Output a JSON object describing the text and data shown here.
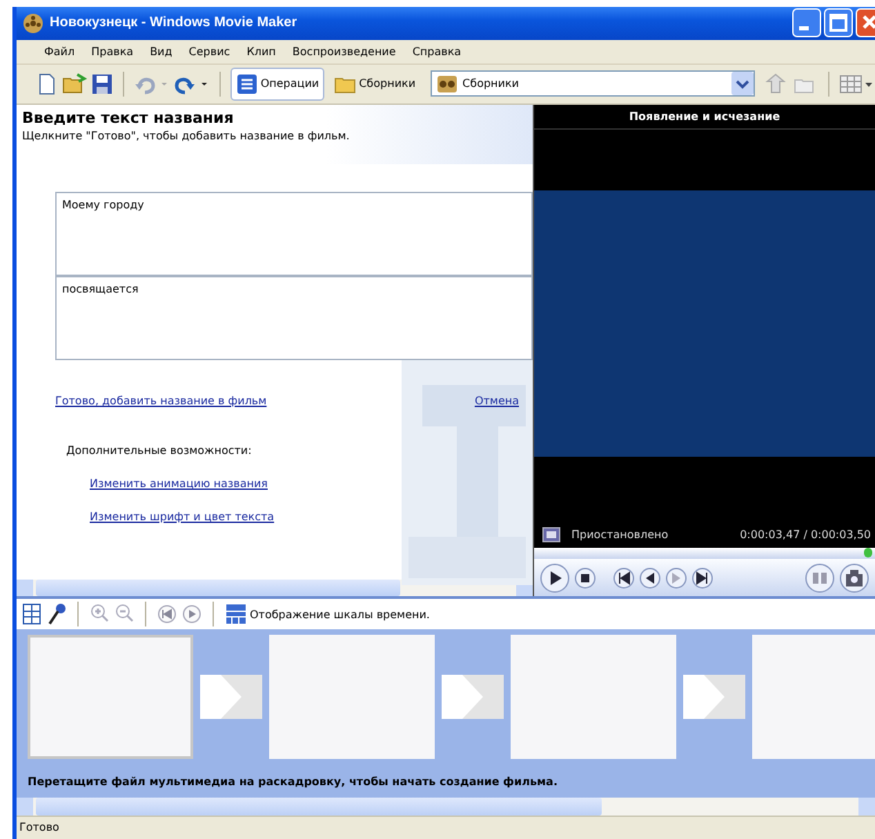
{
  "window": {
    "title": "Новокузнецк - Windows Movie Maker"
  },
  "menu": [
    "Файл",
    "Правка",
    "Вид",
    "Сервис",
    "Клип",
    "Воспроизведение",
    "Справка"
  ],
  "toolbar": {
    "panes": [
      {
        "label": "Операции",
        "selected": true
      },
      {
        "label": "Сборники",
        "selected": false
      }
    ],
    "collection": "Сборники"
  },
  "title_pane": {
    "heading": "Введите текст названия",
    "hint": "Щелкните \"Готово\", чтобы добавить название в фильм.",
    "fields": [
      {
        "value": "Моему городу"
      },
      {
        "value": "посвящается"
      }
    ],
    "done_link": "Готово, добавить название в фильм",
    "cancel_link": "Отмена",
    "more_label": "Дополнительные возможности:",
    "more_links": [
      "Изменить анимацию названия",
      "Изменить шрифт и цвет текста"
    ]
  },
  "preview": {
    "title": "Появление и исчезание",
    "status": "Приостановлено",
    "time": "0:00:03,47 / 0:00:03,50",
    "level": 0.99
  },
  "storyboard": {
    "toggle_label": "Отображение шкалы времени.",
    "frames": [
      {
        "selected": true
      },
      {
        "selected": false
      },
      {
        "selected": false
      },
      {
        "selected": false
      }
    ],
    "hint": "Перетащите файл мультимедиа на раскадровку, чтобы начать создание фильма."
  },
  "status_bar": "Готово"
}
